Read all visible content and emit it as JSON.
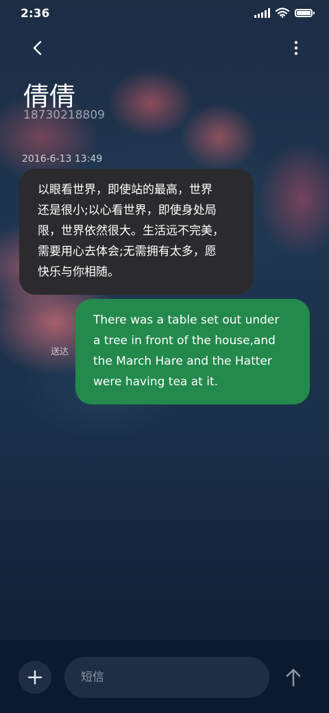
{
  "status_bar": {
    "time": "2:36",
    "icons": [
      "signal-icon",
      "wifi-icon",
      "battery-icon"
    ],
    "battery_level": 1.0
  },
  "header": {
    "back_icon": "back-arrow-icon",
    "more_icon": "more-vertical-icon",
    "contact_name": "倩倩",
    "contact_number": "18730218809"
  },
  "conversation": {
    "timestamp": "2016-6-13 13:49",
    "messages": [
      {
        "direction": "incoming",
        "lines": [
          "以眼看世界，即使站的最高，世界",
          "还是很小;以心看世界，即使身处局",
          "限，世界依然很大。生活远不完美，",
          "需要用心去体会;无需拥有太多，愿",
          "快乐与你相随。"
        ]
      },
      {
        "direction": "outgoing",
        "status": "送达",
        "lines": [
          "There was a table set out under",
          "a tree in front of the house,and",
          "the March Hare and the Hatter",
          "were having tea at it."
        ]
      }
    ]
  },
  "composer": {
    "add_icon": "plus-icon",
    "placeholder": "短信",
    "value": "",
    "send_icon": "arrow-up-icon"
  },
  "colors": {
    "incoming_bubble": "#2b2b2d",
    "outgoing_bubble": "#23894c",
    "bottom_bar": "#0b1a2e",
    "input_bg": "#1e2e45"
  }
}
